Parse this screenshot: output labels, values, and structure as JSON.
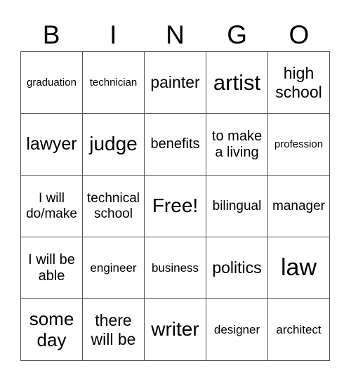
{
  "header": [
    "B",
    "I",
    "N",
    "G",
    "O"
  ],
  "cells": [
    [
      "graduation",
      "technician",
      "painter",
      "artist",
      "high school"
    ],
    [
      "lawyer",
      "judge",
      "benefits",
      "to make a living",
      "profession"
    ],
    [
      "I will do/make",
      "technical school",
      "Free!",
      "bilingual",
      "manager"
    ],
    [
      "I will be able",
      "engineer",
      "business",
      "politics",
      "law"
    ],
    [
      "some day",
      "there will be",
      "writer",
      "designer",
      "architect"
    ]
  ]
}
